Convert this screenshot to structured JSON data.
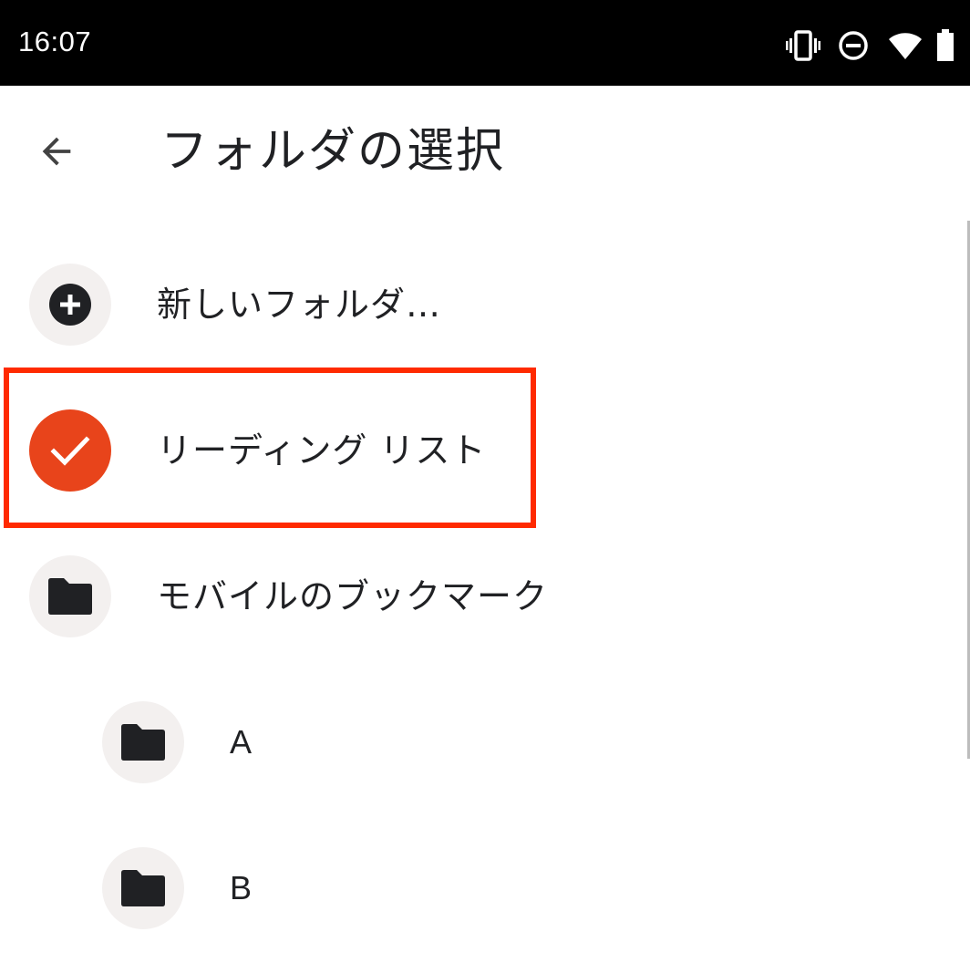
{
  "status_bar": {
    "time": "16:07",
    "icons": [
      "vibrate-icon",
      "do-not-disturb-icon",
      "wifi-icon",
      "battery-icon"
    ]
  },
  "app_bar": {
    "back_icon": "arrow-back-icon",
    "title": "フォルダの選択"
  },
  "folders": [
    {
      "label": "新しいフォルダ…",
      "icon": "add-circle-icon",
      "selected": false
    },
    {
      "label": "リーディング リスト",
      "icon": "check-icon",
      "selected": true
    },
    {
      "label": "モバイルのブックマーク",
      "icon": "folder-icon",
      "selected": false
    },
    {
      "label": "A",
      "icon": "folder-icon",
      "selected": false
    },
    {
      "label": "B",
      "icon": "folder-icon",
      "selected": false
    }
  ],
  "colors": {
    "status_bar_bg": "#000000",
    "selected_accent": "#e8441b",
    "icon_circle_bg": "#f3f0ef",
    "highlight_border": "#ff2a00",
    "text_primary": "#202124"
  }
}
